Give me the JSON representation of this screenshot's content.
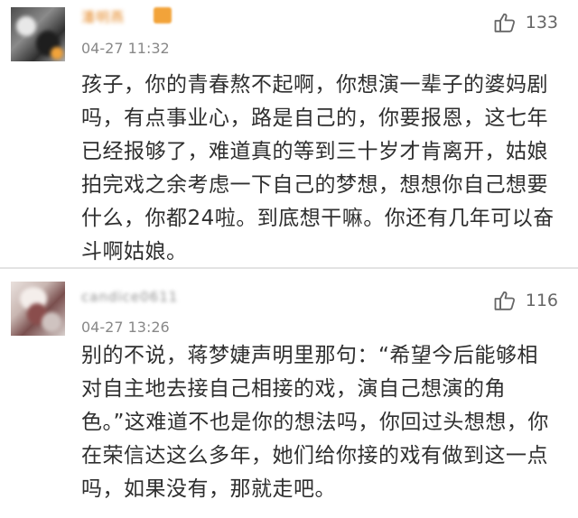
{
  "comments": [
    {
      "username": "潘明燕",
      "time": "04-27 11:32",
      "likes": "133",
      "text": "孩子，你的青春熬不起啊，你想演一辈子的婆妈剧吗，有点事业心，路是自己的，你要报恩，这七年已经报够了，难道真的等到三十岁才肯离开，姑娘拍完戏之余考虑一下自己的梦想，想想你自己想要什么，你都24啦。到底想干嘛。你还有几年可以奋斗啊姑娘。"
    },
    {
      "username": "candice0611",
      "time": "04-27 13:26",
      "likes": "116",
      "text": "别的不说，蒋梦婕声明里那句：“希望今后能够相对自主地去接自己相接的戏，演自己想演的角色。”这难道不也是你的想法吗，你回过头想想，你在荣信达这么多年，她们给你接的戏有做到这一点吗，如果没有，那就走吧。"
    }
  ],
  "icons": {
    "like": "thumbs-up-icon"
  },
  "colors": {
    "username": "#e58b2b",
    "time": "#888888",
    "text": "#2f2f2f",
    "divider": "#e3e3e3"
  }
}
